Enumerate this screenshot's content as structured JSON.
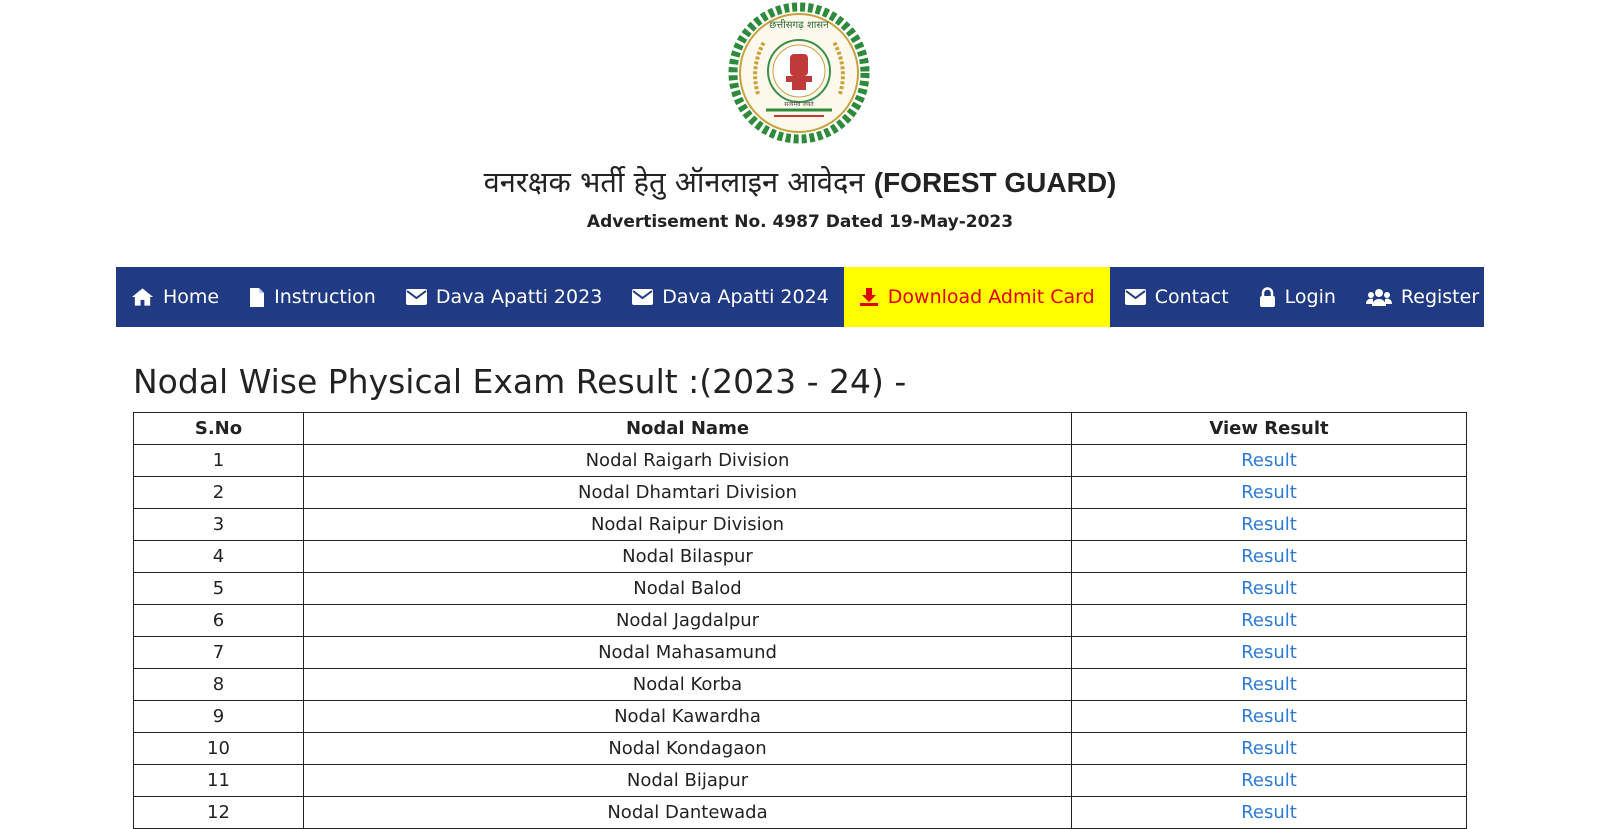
{
  "header": {
    "emblem": {
      "icon": "chhattisgarh-emblem",
      "outer_text": "छत्तीसगढ़ शासन",
      "motto": "सत्यमेव जयते"
    },
    "title_hindi": "वनरक्षक भर्ती हेतु ऑनलाइन आवेदन",
    "title_english": "(FOREST GUARD)",
    "advertisement": "Advertisement No. 4987 Dated 19-May-2023"
  },
  "nav": {
    "items": [
      {
        "label": "Home",
        "icon": "home-icon"
      },
      {
        "label": "Instruction",
        "icon": "file-icon"
      },
      {
        "label": "Dava Apatti 2023",
        "icon": "envelope-icon"
      },
      {
        "label": "Dava Apatti 2024",
        "icon": "envelope-icon"
      },
      {
        "label": "Download Admit Card",
        "icon": "download-icon"
      },
      {
        "label": "Contact",
        "icon": "envelope-icon"
      }
    ],
    "right_items": [
      {
        "label": "Login",
        "icon": "lock-icon"
      },
      {
        "label": "Register",
        "icon": "users-icon"
      }
    ]
  },
  "colors": {
    "nav_bg": "#203a83",
    "highlight_bg": "#ffff00",
    "highlight_text": "#e00000",
    "link": "#2a7ad6"
  },
  "main": {
    "heading": "Nodal Wise Physical Exam Result :(2023 - 24) -",
    "table": {
      "headers": [
        "S.No",
        "Nodal Name",
        "View Result"
      ],
      "rows": [
        {
          "sno": "1",
          "name": "Nodal Raigarh Division",
          "link": "Result"
        },
        {
          "sno": "2",
          "name": "Nodal Dhamtari Division",
          "link": "Result"
        },
        {
          "sno": "3",
          "name": "Nodal Raipur Division",
          "link": "Result"
        },
        {
          "sno": "4",
          "name": "Nodal Bilaspur",
          "link": "Result"
        },
        {
          "sno": "5",
          "name": "Nodal Balod",
          "link": "Result"
        },
        {
          "sno": "6",
          "name": "Nodal Jagdalpur",
          "link": "Result"
        },
        {
          "sno": "7",
          "name": "Nodal Mahasamund",
          "link": "Result"
        },
        {
          "sno": "8",
          "name": "Nodal Korba",
          "link": "Result"
        },
        {
          "sno": "9",
          "name": "Nodal Kawardha",
          "link": "Result"
        },
        {
          "sno": "10",
          "name": "Nodal Kondagaon",
          "link": "Result"
        },
        {
          "sno": "11",
          "name": "Nodal Bijapur",
          "link": "Result"
        },
        {
          "sno": "12",
          "name": "Nodal Dantewada",
          "link": "Result"
        }
      ]
    }
  }
}
